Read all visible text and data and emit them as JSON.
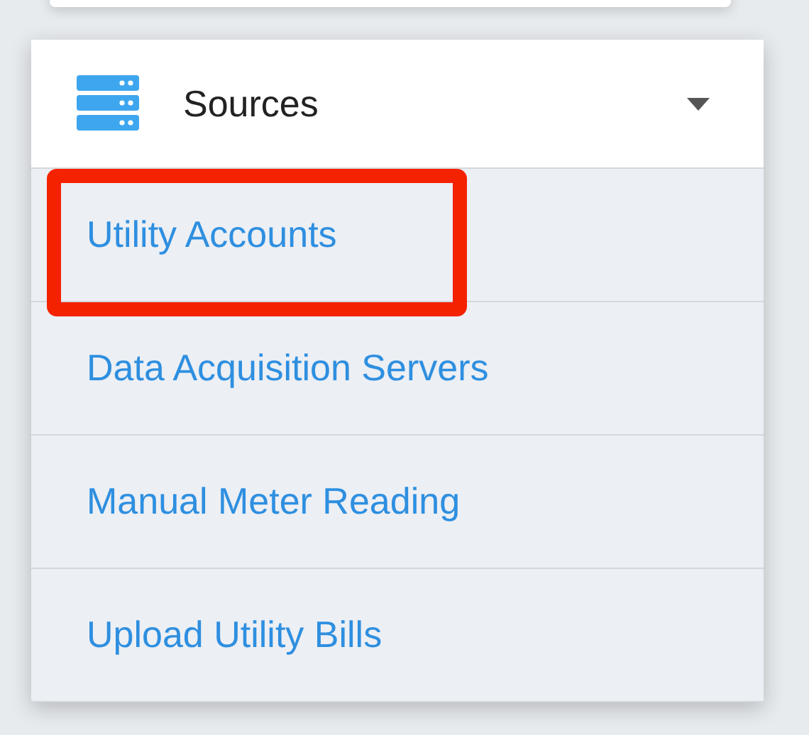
{
  "menu": {
    "title": "Sources",
    "expanded": true,
    "items": [
      {
        "label": "Utility Accounts",
        "highlighted": true
      },
      {
        "label": "Data Acquisition Servers",
        "highlighted": false
      },
      {
        "label": "Manual Meter Reading",
        "highlighted": false
      },
      {
        "label": "Upload Utility Bills",
        "highlighted": false
      }
    ]
  }
}
